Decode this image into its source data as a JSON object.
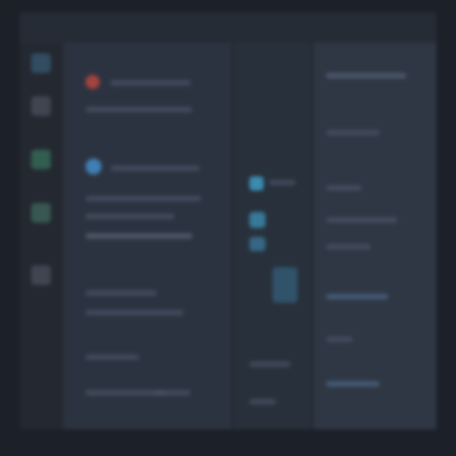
{
  "colors": {
    "background": "#1c2028",
    "panel": "#2c3340",
    "accent_blue": "#3f7fb5",
    "accent_red": "#a4433f",
    "accent_green": "#3f8a6a",
    "accent_teal": "#3b8cb0"
  },
  "activity_bar": {
    "items": [
      {
        "icon": "files-icon"
      },
      {
        "icon": "search-icon"
      },
      {
        "icon": "source-control-icon"
      },
      {
        "icon": "debug-icon"
      },
      {
        "icon": "extensions-icon"
      }
    ]
  }
}
